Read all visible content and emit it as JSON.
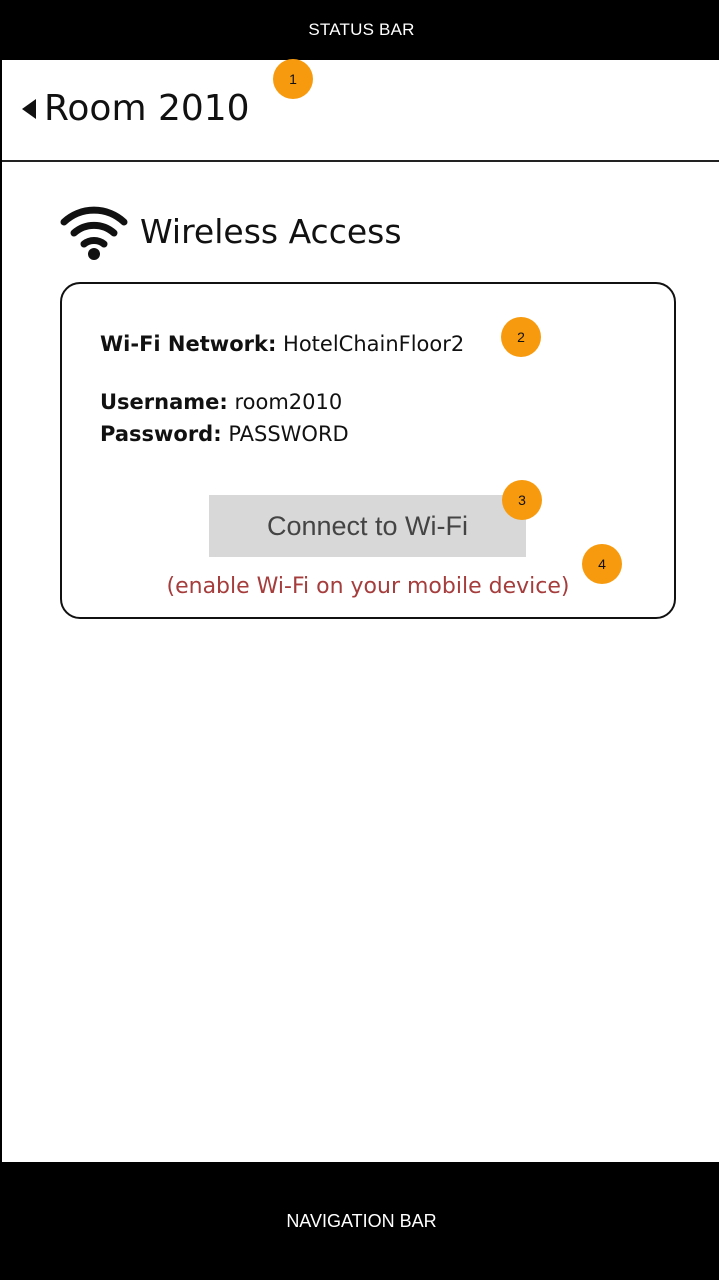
{
  "status_bar": {
    "label": "STATUS BAR"
  },
  "header": {
    "title": "Room 2010"
  },
  "section": {
    "title": "Wireless Access",
    "icon": "wifi-icon"
  },
  "card": {
    "network_label": "Wi-Fi Network:",
    "network_value": "HotelChainFloor2",
    "username_label": "Username:",
    "username_value": "room2010",
    "password_label": "Password:",
    "password_value": "PASSWORD",
    "connect_button": "Connect to Wi-Fi",
    "hint": "(enable Wi-Fi on your mobile device)"
  },
  "annotations": {
    "one": "1",
    "two": "2",
    "three": "3",
    "four": "4"
  },
  "nav_bar": {
    "label": "NAVIGATION BAR"
  },
  "colors": {
    "badge": "#f79a0e",
    "hint": "#a63d3d",
    "button_bg": "#d8d8d8",
    "bars": "#000000"
  }
}
